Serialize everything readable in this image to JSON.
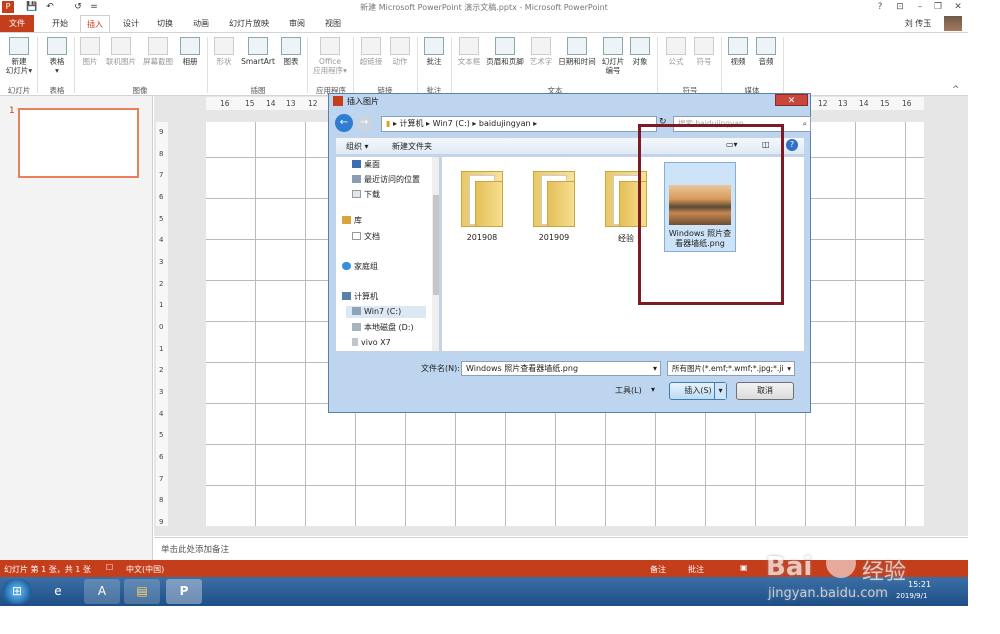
{
  "window": {
    "title": "新建 Microsoft PowerPoint 演示文稿.pptx - Microsoft PowerPoint",
    "user": "刘 传玉",
    "controls": [
      "?",
      "⊡",
      "–",
      "❐",
      "✕"
    ]
  },
  "qat": {
    "save": "💾",
    "undo": "↶",
    "redo": "↺",
    "more": "="
  },
  "tabs": [
    "文件",
    "开始",
    "插入",
    "设计",
    "切换",
    "动画",
    "幻灯片放映",
    "审阅",
    "视图"
  ],
  "active_tab": "插入",
  "ribbon": {
    "items": [
      {
        "label": "新建\n幻灯片▾",
        "group": "幻灯片"
      },
      {
        "label": "表格\n▾",
        "group": "表格"
      },
      {
        "label": "图片",
        "group": "图像"
      },
      {
        "label": "联机图片",
        "group": "图像"
      },
      {
        "label": "屏幕截图",
        "group": "图像"
      },
      {
        "label": "相册",
        "group": "图像"
      },
      {
        "label": "形状",
        "group": "插图"
      },
      {
        "label": "SmartArt",
        "group": "插图"
      },
      {
        "label": "图表",
        "group": "插图"
      },
      {
        "label": "Office\n应用程序▾",
        "group": "应用程序"
      },
      {
        "label": "超链接",
        "group": "链接"
      },
      {
        "label": "动作",
        "group": "链接"
      },
      {
        "label": "批注",
        "group": "批注"
      },
      {
        "label": "文本框",
        "group": "文本"
      },
      {
        "label": "页眉和页脚",
        "group": "文本"
      },
      {
        "label": "艺术字",
        "group": "文本"
      },
      {
        "label": "日期和时间",
        "group": "文本"
      },
      {
        "label": "幻灯片\n编号",
        "group": "文本"
      },
      {
        "label": "对象",
        "group": "文本"
      },
      {
        "label": "公式",
        "group": "符号"
      },
      {
        "label": "符号",
        "group": "符号"
      },
      {
        "label": "视频",
        "group": "媒体"
      },
      {
        "label": "音频",
        "group": "媒体"
      }
    ],
    "groups": [
      "幻灯片",
      "表格",
      "图像",
      "插图",
      "应用程序",
      "链接",
      "批注",
      "文本",
      "符号",
      "媒体"
    ],
    "collapse": "^"
  },
  "ruler": {
    "h_left": [
      "16",
      "15",
      "14",
      "13",
      "12"
    ],
    "h_right": [
      "12",
      "13",
      "14",
      "15",
      "16"
    ],
    "v": [
      "9",
      "8",
      "7",
      "6",
      "5",
      "4",
      "3",
      "2",
      "1",
      "0",
      "1",
      "2",
      "3",
      "4",
      "5",
      "6",
      "7",
      "8",
      "9"
    ]
  },
  "thumb_number": "1",
  "notes_placeholder": "单击此处添加备注",
  "status": {
    "left": "幻灯片 第 1 张，共 1 张",
    "lang": "中文(中国)",
    "notes": "备注",
    "comments": "批注"
  },
  "taskbar": {
    "time": "15:21",
    "date": "2019/9/1"
  },
  "dialog": {
    "title": "插入图片",
    "address": [
      "计算机",
      "Win7 (C:)",
      "baidujingyan"
    ],
    "search_placeholder": "搜索 baidujingyan",
    "organize": "组织 ▾",
    "new_folder": "新建文件夹",
    "nav": [
      {
        "label": "桌面",
        "icon": "desktop-icon"
      },
      {
        "label": "最近访问的位置",
        "icon": "recent-icon"
      },
      {
        "label": "下载",
        "icon": "download-icon"
      },
      {
        "label": "库",
        "icon": "library-icon"
      },
      {
        "label": "文档",
        "icon": "document-icon"
      },
      {
        "label": "家庭组",
        "icon": "homegroup-icon"
      },
      {
        "label": "计算机",
        "icon": "computer-icon"
      },
      {
        "label": "Win7 (C:)",
        "icon": "drive-icon"
      },
      {
        "label": "本地磁盘 (D:)",
        "icon": "drive-icon"
      },
      {
        "label": "vivo X7",
        "icon": "phone-icon"
      }
    ],
    "files": [
      {
        "name": "201908",
        "type": "folder"
      },
      {
        "name": "201909",
        "type": "folder"
      },
      {
        "name": "经验",
        "type": "folder"
      },
      {
        "name": "Windows 照片查看器墙纸.png",
        "type": "image"
      }
    ],
    "filename_label": "文件名(N):",
    "filename_value": "Windows 照片查看器墙纸.png",
    "filter": "所有图片(*.emf;*.wmf;*.jpg;*.ji",
    "tools": "工具(L)",
    "insert": "插入(S)",
    "cancel": "取消",
    "close": "✕"
  },
  "watermark": {
    "brand": "Bai",
    "cn": "经验",
    "url": "jingyan.baidu.com"
  }
}
